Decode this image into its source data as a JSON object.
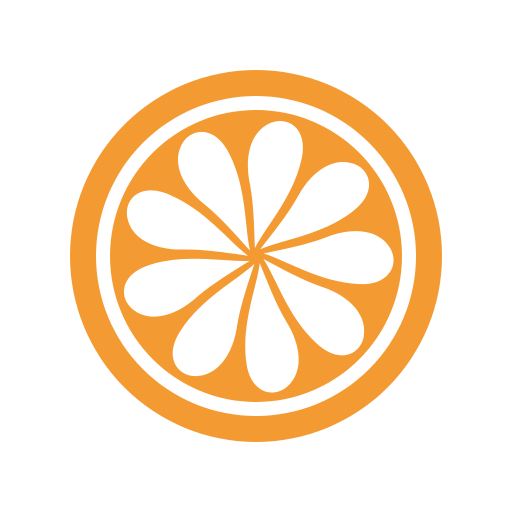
{
  "logo": {
    "icon": "orange-slice-icon",
    "colors": {
      "fill": "#F39B32",
      "background": "#FFFFFF"
    },
    "segment_count": 9
  }
}
